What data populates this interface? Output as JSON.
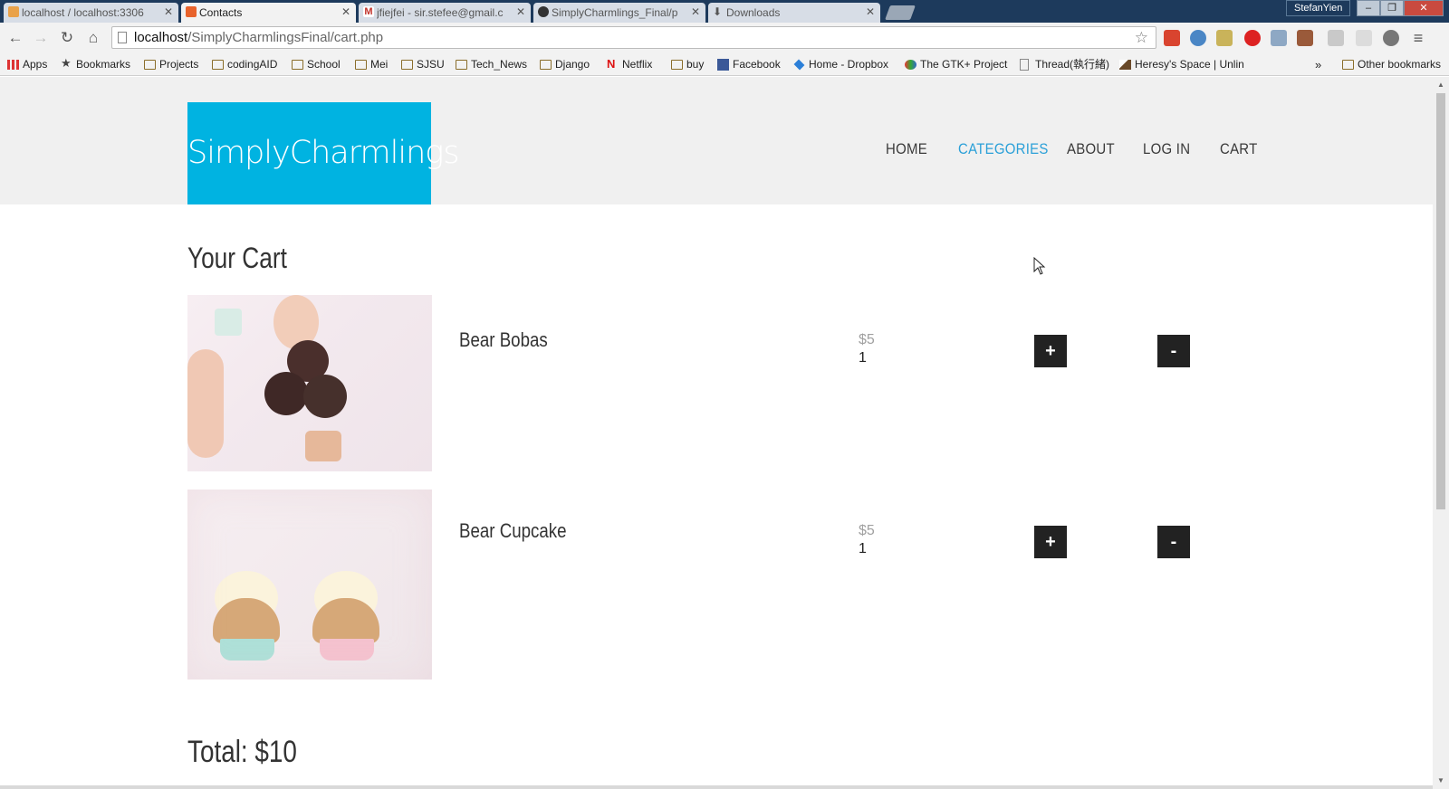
{
  "browser": {
    "tabs": [
      {
        "title": "localhost / localhost:3306",
        "active": false,
        "favicon_color": "#e9a24a"
      },
      {
        "title": "Contacts",
        "active": true,
        "favicon_color": "#e8632c"
      },
      {
        "title": "jfiejfei - sir.stefee@gmail.c",
        "active": false,
        "favicon_color": "#c2322a"
      },
      {
        "title": "SimplyCharmlings_Final/p",
        "active": false,
        "favicon_color": "#333333"
      },
      {
        "title": "Downloads",
        "active": false,
        "favicon_color": "#666666"
      }
    ],
    "profile_name": "StefanYien",
    "window_controls": {
      "minimize": "–",
      "restore": "❐",
      "close": "✕"
    },
    "address": {
      "host": "localhost",
      "path": "/SimplyCharmlingsFinal/cart.php"
    },
    "bookmarks": [
      {
        "label": "Apps",
        "icon": "apps-grid-icon"
      },
      {
        "label": "Bookmarks",
        "icon": "star-icon"
      },
      {
        "label": "Projects",
        "icon": "folder-icon"
      },
      {
        "label": "codingAID",
        "icon": "folder-icon"
      },
      {
        "label": "School",
        "icon": "folder-icon"
      },
      {
        "label": "Mei",
        "icon": "folder-icon"
      },
      {
        "label": "SJSU",
        "icon": "folder-icon"
      },
      {
        "label": "Tech_News",
        "icon": "folder-icon"
      },
      {
        "label": "Django",
        "icon": "folder-icon"
      },
      {
        "label": "Netflix",
        "icon": "netflix-icon"
      },
      {
        "label": "buy",
        "icon": "folder-icon"
      },
      {
        "label": "Facebook",
        "icon": "facebook-icon"
      },
      {
        "label": "Home - Dropbox",
        "icon": "dropbox-icon"
      },
      {
        "label": "The GTK+ Project",
        "icon": "gtk-icon"
      },
      {
        "label": "Thread(執行緒)",
        "icon": "page-icon"
      },
      {
        "label": "Heresy's Space | Unlin",
        "icon": "heresy-icon"
      }
    ],
    "overflow_chevron": "»",
    "other_bookmarks": "Other bookmarks"
  },
  "site": {
    "logo": "SimplyCharmlings",
    "nav": [
      {
        "label": "HOME",
        "active": false
      },
      {
        "label": "CATEGORIES",
        "active": true
      },
      {
        "label": "ABOUT",
        "active": false
      },
      {
        "label": "LOG IN",
        "active": false
      },
      {
        "label": "CART",
        "active": false
      }
    ],
    "accent_color": "#00b3e1",
    "nav_active_color": "#2ba0d8"
  },
  "cart": {
    "title": "Your Cart",
    "items": [
      {
        "name": "Bear Bobas",
        "price": "$5",
        "quantity": "1",
        "plus_label": "+",
        "minus_label": "-"
      },
      {
        "name": "Bear Cupcake",
        "price": "$5",
        "quantity": "1",
        "plus_label": "+",
        "minus_label": "-"
      }
    ],
    "total": "Total: $10"
  }
}
